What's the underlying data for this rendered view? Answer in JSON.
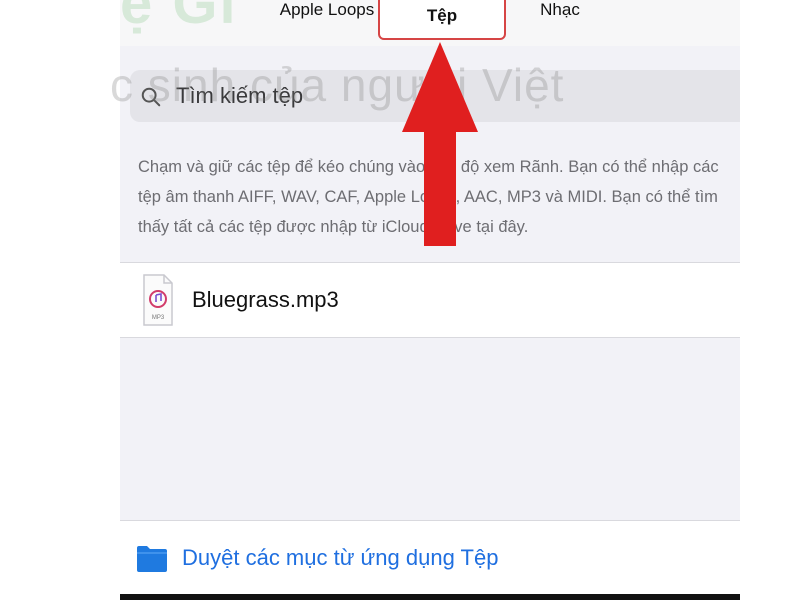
{
  "tabs": {
    "apple_loops": "Apple Loops",
    "files": "Tệp",
    "music": "Nhạc"
  },
  "search": {
    "placeholder": "Tìm kiếm tệp"
  },
  "help_text": "Chạm và giữ các tệp để kéo chúng vào chế độ xem Rãnh. Bạn có thể nhập các tệp âm thanh AIFF, WAV, CAF, Apple Loops, AAC, MP3 và MIDI. Bạn có thể tìm thấy tất cả các tệp được nhập từ iCloud Drive tại đây.",
  "files": [
    {
      "name": "Bluegrass.mp3",
      "icon_label": "MP3"
    }
  ],
  "browse": {
    "label": "Duyệt các mục từ ứng dụng Tệp"
  },
  "watermark": {
    "line1": "ệ Gi",
    "line2": "c sinh của người Việt"
  },
  "colors": {
    "accent_blue": "#1f6fe0",
    "highlight_red": "#d64545",
    "arrow_red": "#e01f1f",
    "background": "#f2f2f7"
  },
  "icons": {
    "search": "search-icon",
    "file": "audio-file-icon",
    "folder": "folder-icon",
    "pointer": "red-arrow-pointer"
  }
}
